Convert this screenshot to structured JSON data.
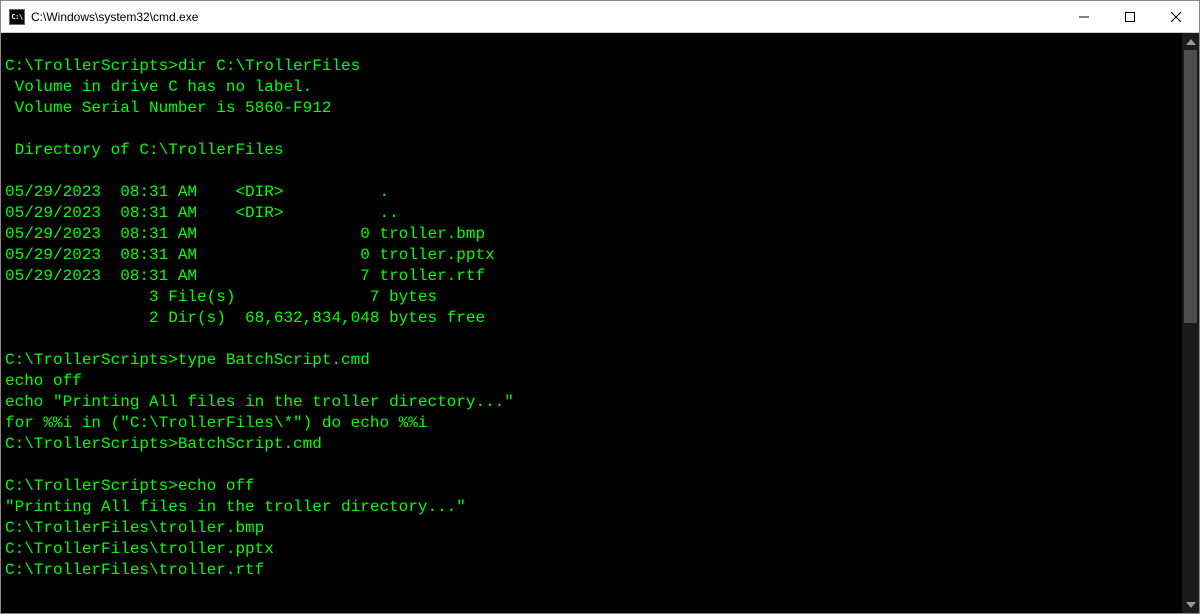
{
  "window": {
    "title": "C:\\Windows\\system32\\cmd.exe"
  },
  "terminal": {
    "lines": [
      "",
      "C:\\TrollerScripts>dir C:\\TrollerFiles",
      " Volume in drive C has no label.",
      " Volume Serial Number is 5860-F912",
      "",
      " Directory of C:\\TrollerFiles",
      "",
      "05/29/2023  08:31 AM    <DIR>          .",
      "05/29/2023  08:31 AM    <DIR>          ..",
      "05/29/2023  08:31 AM                 0 troller.bmp",
      "05/29/2023  08:31 AM                 0 troller.pptx",
      "05/29/2023  08:31 AM                 7 troller.rtf",
      "               3 File(s)              7 bytes",
      "               2 Dir(s)  68,632,834,048 bytes free",
      "",
      "C:\\TrollerScripts>type BatchScript.cmd",
      "echo off",
      "echo \"Printing All files in the troller directory...\"",
      "for %%i in (\"C:\\TrollerFiles\\*\") do echo %%i",
      "C:\\TrollerScripts>BatchScript.cmd",
      "",
      "C:\\TrollerScripts>echo off",
      "\"Printing All files in the troller directory...\"",
      "C:\\TrollerFiles\\troller.bmp",
      "C:\\TrollerFiles\\troller.pptx",
      "C:\\TrollerFiles\\troller.rtf"
    ]
  }
}
